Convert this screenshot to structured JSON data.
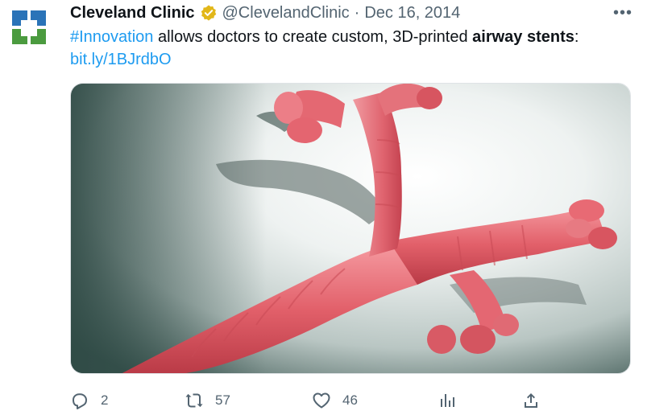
{
  "tweet": {
    "author": {
      "display_name": "Cleveland Clinic",
      "handle": "@ClevelandClinic",
      "verified": true,
      "avatar_icon": "cleveland-clinic-logo",
      "brand_colors": [
        "#2a73b8",
        "#4b9b3f"
      ]
    },
    "separator": "·",
    "date": "Dec 16, 2014",
    "more_label": "•••",
    "text": {
      "hashtag": "#Innovation",
      "middle": " allows doctors to create custom, 3D-printed ",
      "bold": "airway stents",
      "after_bold": ":",
      "link": "bit.ly/1BJrdbO"
    },
    "media": {
      "icon": "3d-printed-airway-stent-photo"
    },
    "actions": {
      "reply": {
        "icon": "reply-icon",
        "count": "2"
      },
      "retweet": {
        "icon": "retweet-icon",
        "count": "57"
      },
      "like": {
        "icon": "heart-icon",
        "count": "46"
      },
      "views": {
        "icon": "views-icon"
      },
      "share": {
        "icon": "share-icon"
      }
    }
  }
}
